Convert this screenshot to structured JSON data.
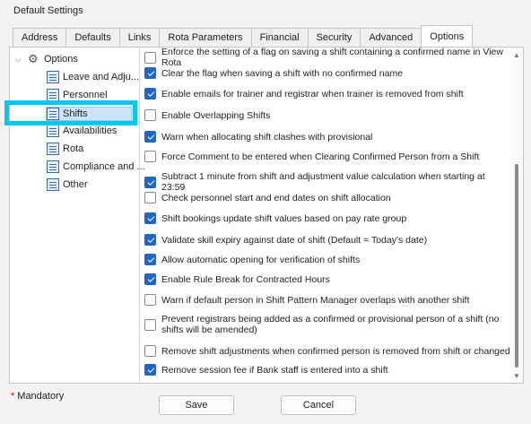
{
  "window": {
    "title": "Default Settings"
  },
  "tabs": [
    "Address",
    "Defaults",
    "Links",
    "Rota Parameters",
    "Financial",
    "Security",
    "Advanced",
    "Options"
  ],
  "active_tab": "Options",
  "tree": {
    "root": "Options",
    "items": [
      "Leave and Adju...",
      "Personnel",
      "Shifts",
      "Availabilities",
      "Rota",
      "Compliance and ...",
      "Other"
    ],
    "selected": "Shifts"
  },
  "options": [
    {
      "label": "Enforce the setting of a flag on saving a shift containing a confirmed name in View Rota",
      "checked": false
    },
    {
      "label": "Clear the flag when saving a shift with no confirmed name",
      "checked": true
    },
    {
      "label": "Enable emails for trainer and registrar when trainer is removed from shift",
      "checked": true
    },
    {
      "label": "Enable Overlapping Shifts",
      "checked": false
    },
    {
      "label": "Warn when allocating shift clashes with provisional",
      "checked": true
    },
    {
      "label": "Force Comment to be entered when Clearing Confirmed Person from a Shift",
      "checked": false
    },
    {
      "label": "Subtract 1 minute from shift and adjustment value calculation when starting at 23:59",
      "checked": true
    },
    {
      "label": "Check personnel start and end dates on shift allocation",
      "checked": false
    },
    {
      "label": "Shift bookings update shift values based on pay rate group",
      "checked": true
    },
    {
      "label": "Validate skill expiry against date of shift (Default = Today's date)",
      "checked": true
    },
    {
      "label": "Allow automatic opening for verification of shifts",
      "checked": true
    },
    {
      "label": "Enable Rule Break for Contracted Hours",
      "checked": true
    },
    {
      "label": "Warn if default person in Shift Pattern Manager overlaps with another shift",
      "checked": false
    },
    {
      "label": "Prevent registrars being added as a confirmed or provisional person of a shift (no shifts will be amended)",
      "checked": false
    },
    {
      "label": "Remove shift adjustments when confirmed person is removed from shift or changed",
      "checked": false
    },
    {
      "label": "Remove session fee if Bank staff is entered into a shift",
      "checked": true
    }
  ],
  "footer": {
    "mandatory_star": "*",
    "mandatory_label": "Mandatory",
    "save_label": "Save",
    "cancel_label": "Cancel"
  },
  "colors": {
    "accent": "#1f67c7",
    "highlight": "#00c8f0"
  }
}
